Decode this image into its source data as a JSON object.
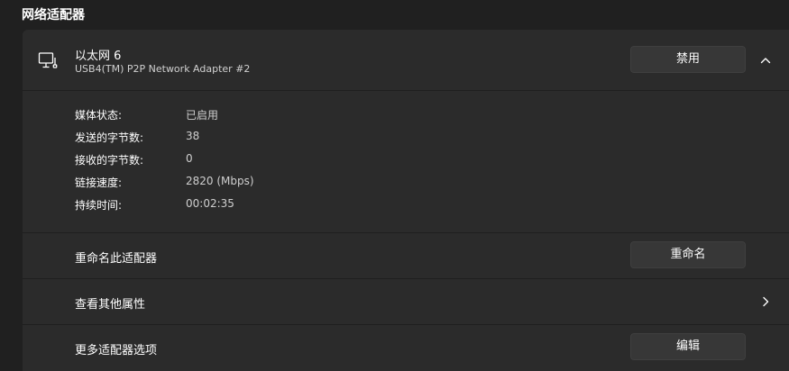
{
  "section": {
    "title": "网络适配器"
  },
  "adapter": {
    "name": "以太网 6",
    "description": "USB4(TM) P2P Network Adapter #2",
    "disable_label": "禁用",
    "icon": "monitor-network-icon",
    "expand_icon": "chevron-up-icon"
  },
  "details": [
    {
      "label": "媒体状态:",
      "value": "已启用"
    },
    {
      "label": "发送的字节数:",
      "value": "38"
    },
    {
      "label": "接收的字节数:",
      "value": "0"
    },
    {
      "label": "链接速度:",
      "value": "2820 (Mbps)"
    },
    {
      "label": "持续时间:",
      "value": "00:02:35"
    }
  ],
  "rename": {
    "label": "重命名此适配器",
    "button_label": "重命名"
  },
  "properties": {
    "label": "查看其他属性",
    "icon": "chevron-right-icon"
  },
  "more_options": {
    "label": "更多适配器选项",
    "button_label": "编辑"
  },
  "colors": {
    "background": "#202020",
    "card": "#2b2b2b",
    "button": "#373737"
  }
}
